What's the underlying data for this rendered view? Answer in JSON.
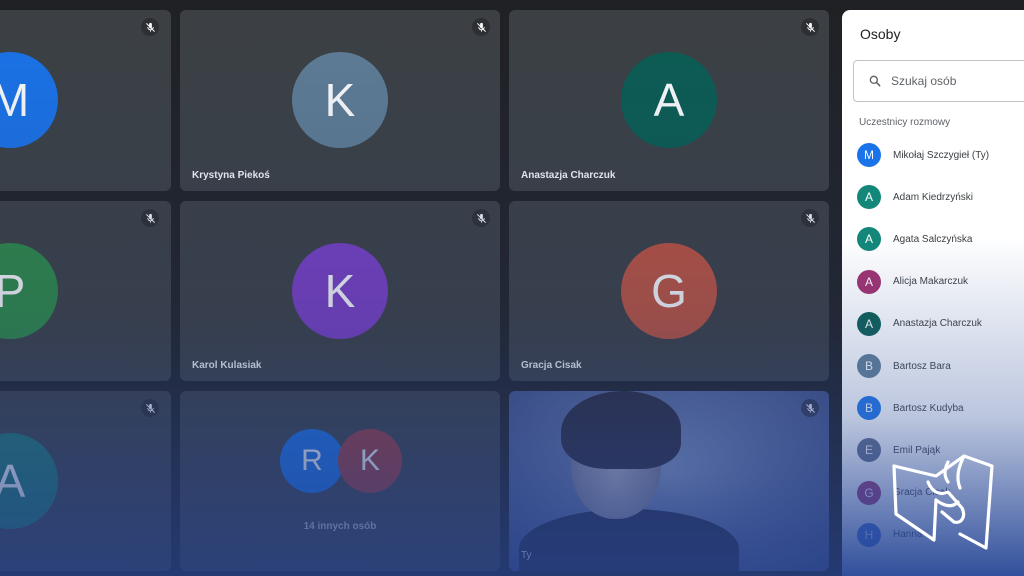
{
  "tiles": [
    {
      "id": "m",
      "name": "",
      "initial": "M",
      "color": "#1a73e8"
    },
    {
      "id": "krystyna",
      "name": "Krystyna Piekoś",
      "initial": "K",
      "color": "#5f7d95"
    },
    {
      "id": "anastazja",
      "name": "Anastazja Charczuk",
      "initial": "A",
      "color": "#0b5d52"
    },
    {
      "id": "p",
      "name": "",
      "initial": "P",
      "color": "#2e8b45"
    },
    {
      "id": "karol",
      "name": "Karol Kulasiak",
      "initial": "K",
      "color": "#7b3fc6"
    },
    {
      "id": "gracja",
      "name": "Gracja Cisak",
      "initial": "G",
      "color": "#c0533d"
    },
    {
      "id": "a2",
      "name": "",
      "initial": "A",
      "color": "#1d7a6e"
    }
  ],
  "others": {
    "label": "14 innych osób",
    "initials": [
      "R",
      "K"
    ],
    "colors": [
      "#1a73e8",
      "#a03a3a"
    ]
  },
  "self_tile": {
    "name": "Ty"
  },
  "panel": {
    "title": "Osoby",
    "search_placeholder": "Szukaj osób",
    "section_label": "Uczestnicy rozmowy",
    "participants": [
      {
        "name": "Mikołaj Szczygieł (Ty)",
        "initial": "M",
        "color": "#1a73e8"
      },
      {
        "name": "Adam Kiedrzyński",
        "initial": "A",
        "color": "#12877a"
      },
      {
        "name": "Agata Salczyńska",
        "initial": "A",
        "color": "#12877a"
      },
      {
        "name": "Alicja Makarczuk",
        "initial": "A",
        "color": "#a0306e"
      },
      {
        "name": "Anastazja Charczuk",
        "initial": "A",
        "color": "#0b5d52"
      },
      {
        "name": "Bartosz Bara",
        "initial": "B",
        "color": "#5f7d95"
      },
      {
        "name": "Bartosz Kudyba",
        "initial": "B",
        "color": "#1a73e8"
      },
      {
        "name": "Emil Pająk",
        "initial": "E",
        "color": "#5f6b85"
      },
      {
        "name": "Gracja Cisak",
        "initial": "G",
        "color": "#a0306e"
      },
      {
        "name": "Hanna",
        "initial": "H",
        "color": "#3c66d6"
      }
    ]
  },
  "icons": {
    "mute": "mic-off-icon",
    "search": "search-icon",
    "logo": "hand-logo"
  }
}
